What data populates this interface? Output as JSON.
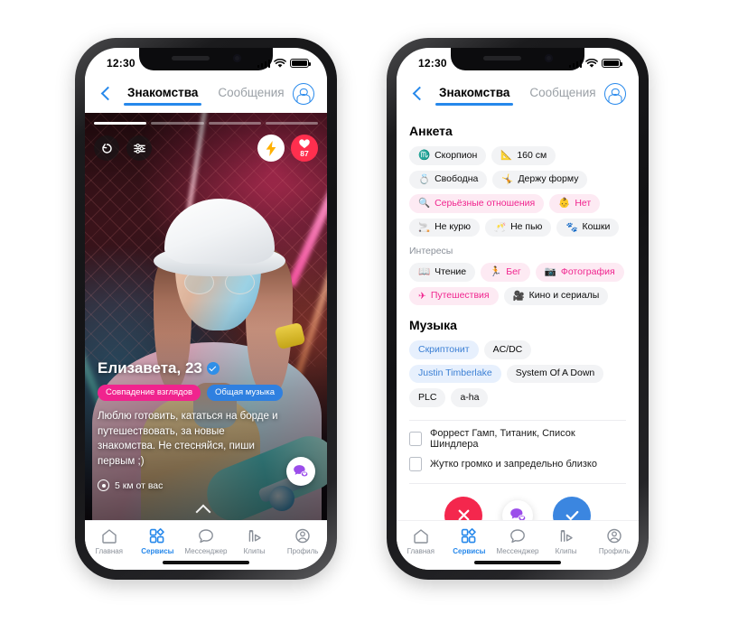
{
  "status_bar": {
    "time": "12:30",
    "signal_icon": "cellular-bars-icon",
    "wifi_icon": "wifi-icon",
    "battery_icon": "battery-icon"
  },
  "header": {
    "back_icon": "back-chevron-icon",
    "tabs": [
      {
        "label": "Знакомства",
        "active": true
      },
      {
        "label": "Сообщения",
        "active": false
      }
    ],
    "profile_icon": "account-circle-icon"
  },
  "left_phone": {
    "card": {
      "progress_total": 4,
      "progress_current": 1,
      "controls": {
        "rewind_icon": "rewind-arrow-icon",
        "filters_icon": "sliders-icon",
        "boost_icon": "lightning-bolt-icon",
        "likes_icon": "heart-icon",
        "likes_count": "87"
      },
      "name": "Елизавета, 23",
      "verified_icon": "verified-check-icon",
      "badges": [
        {
          "label": "Совпадение взглядов",
          "color": "#f0248e"
        },
        {
          "label": "Общая музыка",
          "color": "#2f80e0"
        }
      ],
      "bio": "Люблю готовить, кататься на борде и путешествовать, за новые знакомства. Не стесняйся, пиши первым ;)",
      "location_icon": "location-pin-icon",
      "location": "5 км от вас",
      "chat_fab_icon": "chat-heart-icon",
      "swipe_up_icon": "chevron-up-icon",
      "photo_alt": "Девушка в белой панаме и очках со скейтбордом в неоновом свете"
    }
  },
  "right_phone": {
    "profile_section": {
      "title": "Анкета",
      "chips": [
        {
          "emoji": "♏",
          "label": "Скорпион",
          "style": "plain",
          "icon": "zodiac-scorpio-icon"
        },
        {
          "emoji": "📐",
          "label": "160 см",
          "style": "plain",
          "icon": "ruler-icon"
        },
        {
          "emoji": "💍",
          "label": "Свободна",
          "style": "plain",
          "icon": "ring-icon"
        },
        {
          "emoji": "🤸",
          "label": "Держу форму",
          "style": "plain",
          "icon": "fitness-icon"
        },
        {
          "emoji": "🔍",
          "label": "Серьёзные отношения",
          "style": "pinkish",
          "icon": "magnifier-icon"
        },
        {
          "emoji": "👶",
          "label": "Нет",
          "style": "pinkish",
          "icon": "baby-icon"
        },
        {
          "emoji": "🚬",
          "label": "Не курю",
          "style": "plain",
          "icon": "cigarette-icon"
        },
        {
          "emoji": "🥂",
          "label": "Не пью",
          "style": "plain",
          "icon": "glasses-cheers-icon"
        },
        {
          "emoji": "🐾",
          "label": "Кошки",
          "style": "plain",
          "icon": "paw-icon"
        }
      ]
    },
    "interests_section": {
      "title": "Интересы",
      "chips": [
        {
          "emoji": "📖",
          "label": "Чтение",
          "style": "plain",
          "icon": "book-icon"
        },
        {
          "emoji": "🏃",
          "label": "Бег",
          "style": "pinkish",
          "icon": "running-icon"
        },
        {
          "emoji": "📷",
          "label": "Фотография",
          "style": "pinkish",
          "icon": "camera-icon"
        },
        {
          "emoji": "✈",
          "label": "Путешествия",
          "style": "pinkish",
          "icon": "airplane-icon"
        },
        {
          "emoji": "🎥",
          "label": "Кино и сериалы",
          "style": "plain",
          "icon": "movie-camera-icon"
        }
      ]
    },
    "music_section": {
      "title": "Музыка",
      "chips": [
        {
          "label": "Скриптонит",
          "style": "bluish"
        },
        {
          "label": "AC/DC",
          "style": "plain"
        },
        {
          "label": "Justin Timberlake",
          "style": "bluish"
        },
        {
          "label": "System Of A Down",
          "style": "plain"
        },
        {
          "label": "PLC",
          "style": "plain"
        },
        {
          "label": "a-ha",
          "style": "plain"
        }
      ]
    },
    "media_rows": [
      {
        "icon": "film-strip-icon",
        "text": "Форрест Гамп, Титаник, Список Шиндлера"
      },
      {
        "icon": "book-closed-icon",
        "text": "Жутко громко и запредельно близко"
      }
    ],
    "actions": [
      {
        "name": "dislike",
        "icon": "cross-icon",
        "color": "#f4274d"
      },
      {
        "name": "message",
        "icon": "chat-heart-icon",
        "color": "#ffffff"
      },
      {
        "name": "like",
        "icon": "check-icon",
        "color": "#3b86e0"
      }
    ]
  },
  "bottom_nav": {
    "items": [
      {
        "label": "Главная",
        "icon": "home-icon",
        "active": false
      },
      {
        "label": "Сервисы",
        "icon": "services-grid-icon",
        "active": true
      },
      {
        "label": "Мессенджер",
        "icon": "chat-bubble-icon",
        "active": false
      },
      {
        "label": "Клипы",
        "icon": "clips-play-icon",
        "active": false
      },
      {
        "label": "Профиль",
        "icon": "profile-circle-icon",
        "active": false
      }
    ]
  },
  "colors": {
    "accent_blue": "#2688eb",
    "pink": "#f0248e",
    "red": "#f4274d",
    "like_blue": "#3b86e0",
    "muted": "#8a9099"
  }
}
